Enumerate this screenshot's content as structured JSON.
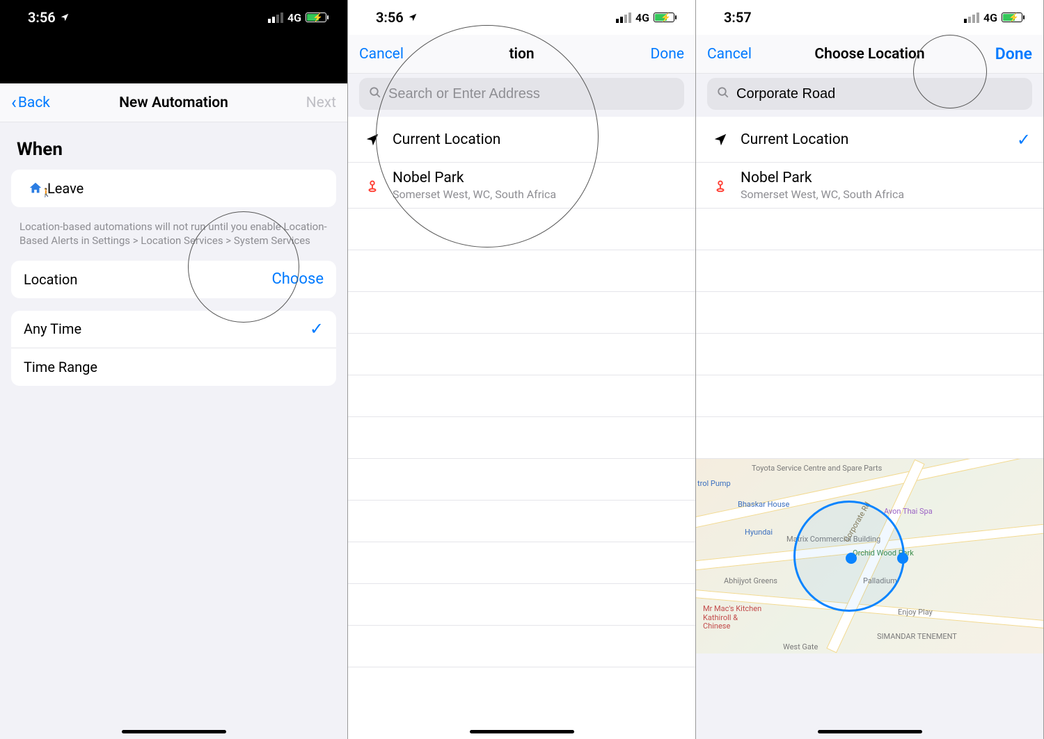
{
  "status": {
    "time1": "3:56",
    "time2": "3:56",
    "time3": "3:57",
    "network": "4G"
  },
  "screen1": {
    "nav_back": "Back",
    "nav_title": "New Automation",
    "nav_next": "Next",
    "section_when": "When",
    "row_leave": "Leave",
    "footnote": "Location-based automations will not run until you enable Location-Based Alerts in Settings > Location Services > System Services",
    "row_location": "Location",
    "choose": "Choose",
    "row_anytime": "Any Time",
    "row_timerange": "Time Range"
  },
  "screen2": {
    "nav_cancel": "Cancel",
    "nav_title_fragment": "tion",
    "nav_done": "Done",
    "search_placeholder": "Search or Enter Address",
    "items": [
      {
        "title": "Current Location",
        "subtitle": ""
      },
      {
        "title": "Nobel Park",
        "subtitle": "Somerset West, WC, South Africa"
      }
    ]
  },
  "screen3": {
    "nav_cancel": "Cancel",
    "nav_title": "Choose Location",
    "nav_done": "Done",
    "search_value": "Corporate Road",
    "items": [
      {
        "title": "Current Location",
        "subtitle": ""
      },
      {
        "title": "Nobel Park",
        "subtitle": "Somerset West, WC, South Africa"
      }
    ],
    "map_center_label": "Corporate Rd",
    "map_pois": {
      "toyota": "Toyota Service Centre and Spare Parts",
      "bhaskar": "Bhaskar House",
      "hyundai": "Hyundai",
      "abhijyot": "Abhijyot Greens",
      "matrix": "Matrix Commercial Building",
      "palladium": "Palladium",
      "orchid": "Orchid Wood Park",
      "avon": "Avon Thai Spa",
      "mrmac": "Mr Mac's Kitchen Kathiroll & Chinese",
      "simandar": "SIMANDAR TENEMENT",
      "enjoy": "Enjoy Play",
      "westgate": "West Gate",
      "petrol": "trol Pump"
    }
  }
}
